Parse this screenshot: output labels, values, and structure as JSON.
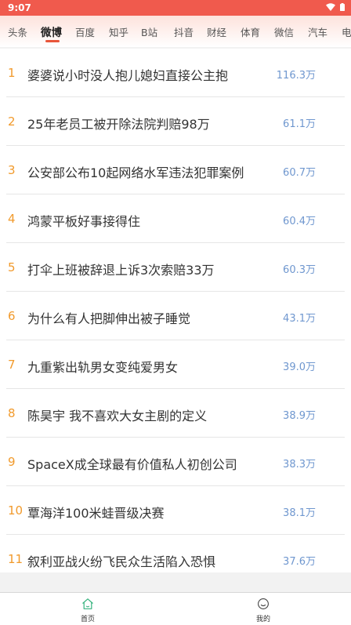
{
  "status_bar": {
    "time": "9:07",
    "icons": [
      "wifi-icon",
      "battery-icon"
    ]
  },
  "tabs": [
    {
      "label": "头条"
    },
    {
      "label": "微博"
    },
    {
      "label": "百度"
    },
    {
      "label": "知乎"
    },
    {
      "label": "B站"
    },
    {
      "label": "抖音"
    },
    {
      "label": "财经"
    },
    {
      "label": "体育"
    },
    {
      "label": "微信"
    },
    {
      "label": "汽车"
    },
    {
      "label": "电"
    }
  ],
  "active_tab": "微博",
  "list": {
    "items": [
      {
        "rank": "1",
        "title": "婆婆说小时没人抱儿媳妇直接公主抱",
        "heat": "116.3万"
      },
      {
        "rank": "2",
        "title": "25年老员工被开除法院判赔98万",
        "heat": "61.1万"
      },
      {
        "rank": "3",
        "title": "公安部公布10起网络水军违法犯罪案例",
        "heat": "60.7万"
      },
      {
        "rank": "4",
        "title": "鸿蒙平板好事接得住",
        "heat": "60.4万"
      },
      {
        "rank": "5",
        "title": "打伞上班被辞退上诉3次索赔33万",
        "heat": "60.3万"
      },
      {
        "rank": "6",
        "title": "为什么有人把脚伸出被子睡觉",
        "heat": "43.1万"
      },
      {
        "rank": "7",
        "title": "九重紫出轨男女变纯爱男女",
        "heat": "39.0万"
      },
      {
        "rank": "8",
        "title": "陈昊宇 我不喜欢大女主剧的定义",
        "heat": "38.9万"
      },
      {
        "rank": "9",
        "title": "SpaceX成全球最有价值私人初创公司",
        "heat": "38.3万"
      },
      {
        "rank": "10",
        "title": "覃海洋100米蛙晋级决赛",
        "heat": "38.1万"
      },
      {
        "rank": "11",
        "title": "叙利亚战火纷飞民众生活陷入恐惧",
        "heat": "37.6万"
      }
    ]
  },
  "bottom_nav": {
    "home_label": "首页",
    "home_icon": "home-icon",
    "mine_label": "我的",
    "mine_icon": "smile-face-icon"
  },
  "colors": {
    "status_bar": "#f05a4d",
    "rank": "#f19a2c",
    "heat": "#6f97cf",
    "tab_underline": "#e8553a"
  }
}
